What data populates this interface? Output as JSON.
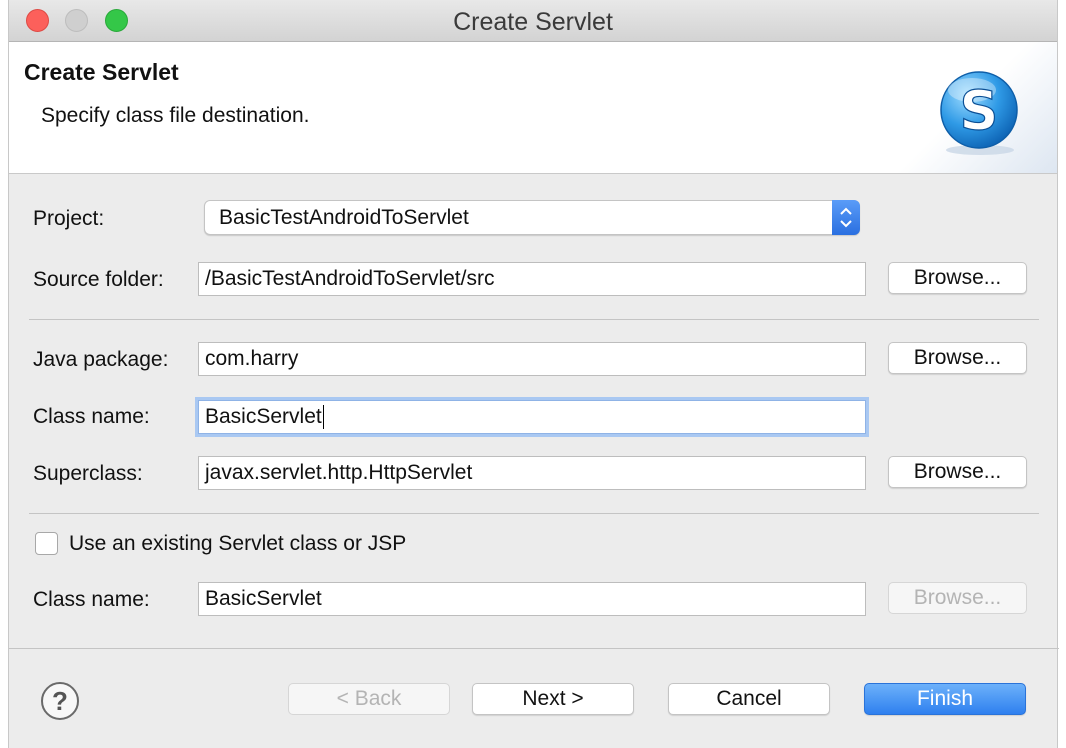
{
  "window": {
    "title": "Create Servlet"
  },
  "header": {
    "title": "Create Servlet",
    "description": "Specify class file destination.",
    "logo_letter": "S"
  },
  "form": {
    "project": {
      "label": "Project:",
      "value": "BasicTestAndroidToServlet"
    },
    "source_folder": {
      "label": "Source folder:",
      "value": "/BasicTestAndroidToServlet/src",
      "browse": "Browse..."
    },
    "java_package": {
      "label": "Java package:",
      "value": "com.harry",
      "browse": "Browse..."
    },
    "class_name": {
      "label": "Class name:",
      "value": "BasicServlet"
    },
    "superclass": {
      "label": "Superclass:",
      "value": "javax.servlet.http.HttpServlet",
      "browse": "Browse..."
    },
    "use_existing": {
      "label": "Use an existing Servlet class or JSP",
      "checked": false
    },
    "existing_class": {
      "label": "Class name:",
      "value": "BasicServlet",
      "browse": "Browse..."
    }
  },
  "footer": {
    "help_glyph": "?",
    "back": "< Back",
    "next": "Next >",
    "cancel": "Cancel",
    "finish": "Finish"
  },
  "colors": {
    "accent": "#2f80ef",
    "focus_ring": "#a9c8f2"
  }
}
